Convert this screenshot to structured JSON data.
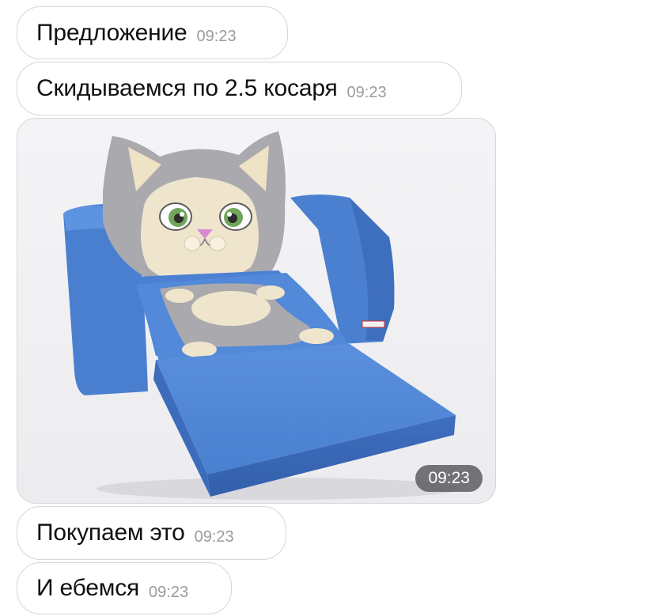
{
  "messages": [
    {
      "type": "text",
      "text": "Предложение",
      "time": "09:23"
    },
    {
      "type": "text",
      "text": "Скидываемся по 2.5 косаря",
      "time": "09:23"
    },
    {
      "type": "photo",
      "image": "kids-cat-fold-out-armchair-photo",
      "time": "09:23"
    },
    {
      "type": "text",
      "text": "Покупаем это",
      "time": "09:23"
    },
    {
      "type": "text",
      "text": "И ебемся",
      "time": "09:23"
    }
  ],
  "colors": {
    "background": "#ffffff",
    "bubble_border": "#d6d6da",
    "time_text": "#9a9aa0",
    "sofa_blue": "#4f86d6",
    "cat_gray": "#a7a7ab",
    "cat_cream": "#efe5cc"
  }
}
